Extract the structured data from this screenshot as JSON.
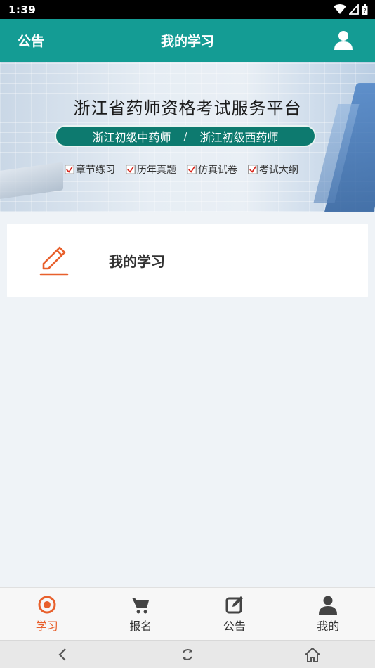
{
  "status_bar": {
    "time": "1:39",
    "icons": [
      "wifi-icon",
      "signal-icon",
      "battery-icon"
    ]
  },
  "app_bar": {
    "left_label": "公告",
    "title": "我的学习",
    "right_icon": "user-icon",
    "background": "#149c94"
  },
  "banner": {
    "title": "浙江省药师资格考试服务平台",
    "pill_left": "浙江初级中药师",
    "pill_separator": "/",
    "pill_right": "浙江初级西药师",
    "checks": [
      "章节练习",
      "历年真题",
      "仿真试卷",
      "考试大纲"
    ]
  },
  "study_card": {
    "icon": "pencil-icon",
    "label": "我的学习",
    "icon_color": "#e8602c"
  },
  "bottom_nav": {
    "items": [
      {
        "label": "学习",
        "icon": "target-icon",
        "active": true
      },
      {
        "label": "报名",
        "icon": "cart-icon",
        "active": false
      },
      {
        "label": "公告",
        "icon": "edit-icon",
        "active": false
      },
      {
        "label": "我的",
        "icon": "person-icon",
        "active": false
      }
    ],
    "active_color": "#e8602c"
  },
  "system_nav": {
    "buttons": [
      "back-icon",
      "rotate-icon",
      "home-icon"
    ]
  }
}
